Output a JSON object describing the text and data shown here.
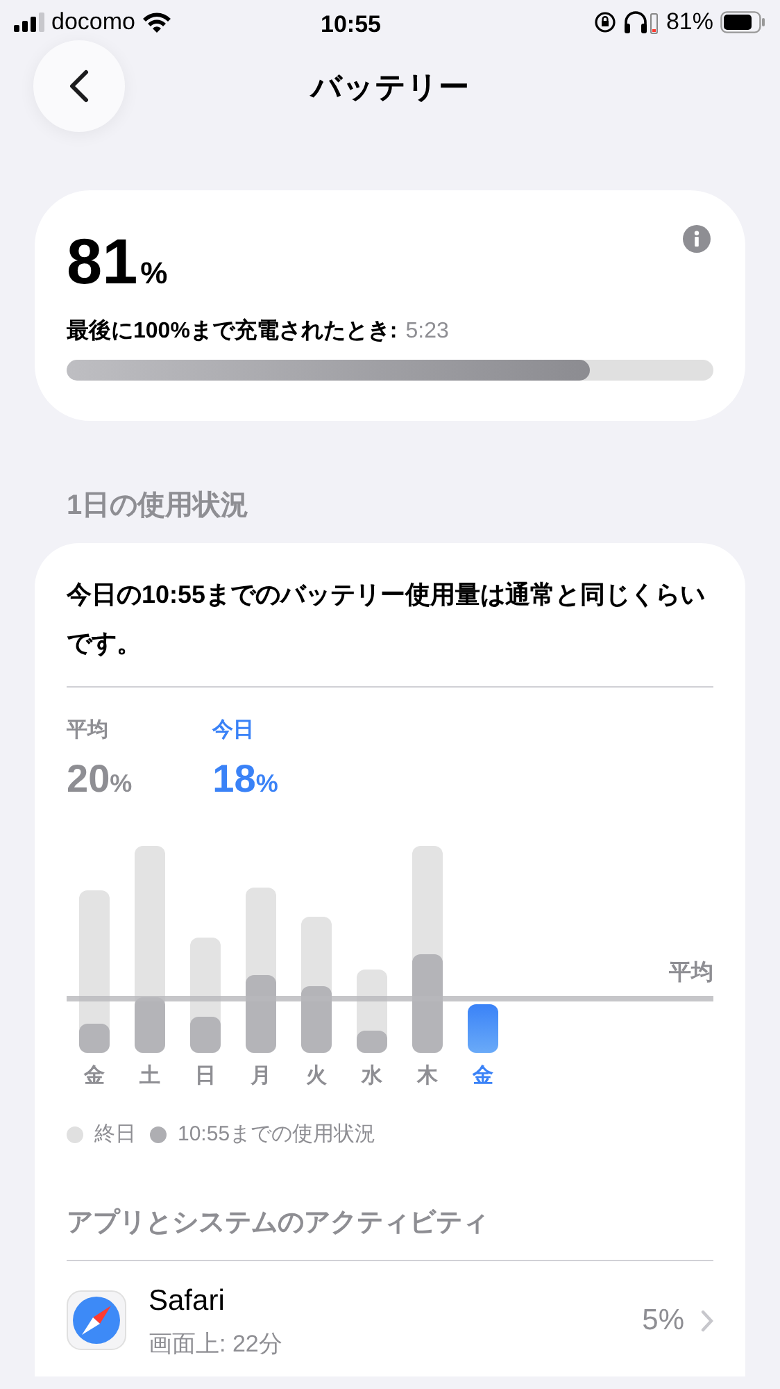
{
  "status_bar": {
    "carrier": "docomo",
    "time": "10:55",
    "battery_text": "81%"
  },
  "nav": {
    "title": "バッテリー"
  },
  "battery_card": {
    "percent": "81",
    "percent_unit": "%",
    "last_charge_label": "最後に100%まで充電されたとき:",
    "last_charge_time": "5:23",
    "level": 0.81
  },
  "usage_section": {
    "header": "1日の使用状況",
    "summary": "今日の10:55までのバッテリー使用量は通常と同じくらいです。",
    "average": {
      "label": "平均",
      "value": "20",
      "unit": "%"
    },
    "today": {
      "label": "今日",
      "value": "18",
      "unit": "%"
    },
    "average_line_label": "平均",
    "days": [
      {
        "label": "金",
        "selected": false
      },
      {
        "label": "土",
        "selected": false
      },
      {
        "label": "日",
        "selected": false
      },
      {
        "label": "月",
        "selected": false
      },
      {
        "label": "火",
        "selected": false
      },
      {
        "label": "水",
        "selected": false
      },
      {
        "label": "木",
        "selected": false
      },
      {
        "label": "金",
        "selected": true
      }
    ],
    "legend": [
      {
        "label": "終日",
        "color": "#e0e0e0"
      },
      {
        "label": "10:55までの使用状況",
        "color": "#aeaeb2"
      }
    ]
  },
  "activity_section": {
    "header": "アプリとシステムのアクティビティ",
    "apps": [
      {
        "name": "Safari",
        "detail": "画面上: 22分",
        "percent": "5%"
      }
    ]
  }
}
